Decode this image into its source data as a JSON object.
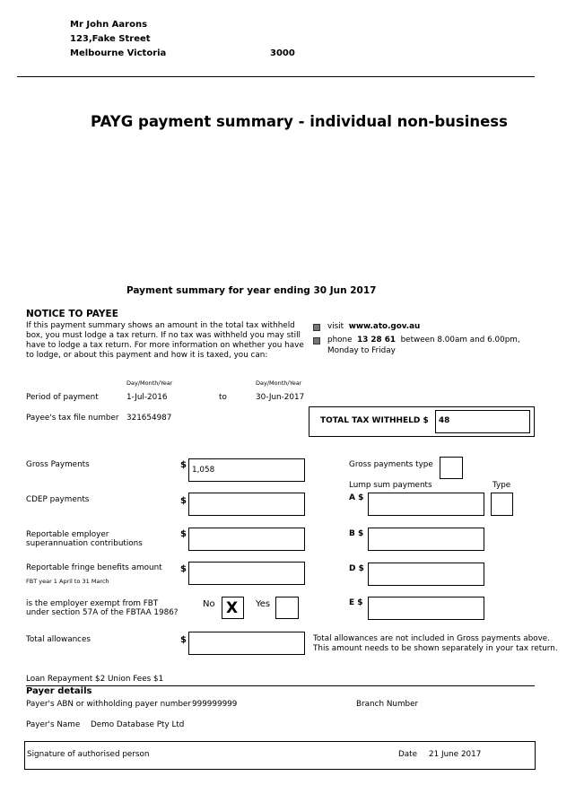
{
  "payee_address": {
    "name": "Mr John  Aarons",
    "street": "123,Fake Street",
    "city": "Melbourne Victoria",
    "postcode": "3000"
  },
  "document_title": "PAYG payment summary - individual non-business",
  "year_ending": {
    "label": "Payment summary for year ending",
    "value": "30 Jun 2017"
  },
  "notice": {
    "heading": "NOTICE TO PAYEE",
    "body_lines": [
      "If this payment summary shows an amount in the total tax withheld",
      "box, you must lodge a tax return. If no tax was withheld you may still",
      "have to lodge a tax return. For more information on whether you have",
      "to lodge, or about this payment and how it is taxed, you can:"
    ],
    "visit_label": "visit",
    "visit_url": "www.ato.gov.au",
    "phone_label": "phone",
    "phone_number": "13 28 61",
    "phone_hours": "between 8.00am and 6.00pm,",
    "phone_days": "Monday to Friday"
  },
  "period": {
    "date_format_label": "Day/Month/Year",
    "label": "Period of payment",
    "from": "1-Jul-2016",
    "to_label": "to",
    "to": "30-Jun-2017"
  },
  "tfn": {
    "label": "Payee's tax file number",
    "value": "321654987"
  },
  "total_tax": {
    "label": "TOTAL TAX WITHHELD $",
    "value": "48"
  },
  "fields": {
    "currency_symbol": "$",
    "gross_payments": {
      "label": "Gross Payments",
      "value": "1,058"
    },
    "cdep_payments": {
      "label": "CDEP  payments",
      "value": ""
    },
    "super_contributions": {
      "label_line1": "Reportable employer",
      "label_line2": "superannuation contributions",
      "value": ""
    },
    "fringe_benefits": {
      "label": "Reportable fringe benefits amount",
      "note": "FBT year 1 April to 31 March",
      "value": ""
    },
    "fbt_exempt": {
      "label_line1": "is the employer exempt from FBT",
      "label_line2": "under section 57A of the FBTAA 1986?",
      "no_label": "No",
      "no_mark": "X",
      "yes_label": "Yes",
      "yes_mark": ""
    },
    "total_allowances": {
      "label": "Total allowances",
      "value": "",
      "note_line1": "Total allowances are not included in Gross payments above.",
      "note_line2": "This amount needs to be shown separately in your tax return."
    }
  },
  "right_column": {
    "gross_payments_type_label": "Gross payments type",
    "gross_payments_type_value": "",
    "lump_sum_label": "Lump sum payments",
    "type_label": "Type",
    "a_label": "A  $",
    "a_value": "",
    "a_type": "",
    "b_label": "B  $",
    "b_value": "",
    "d_label": "D  $",
    "d_value": "",
    "e_label": "E  $",
    "e_value": ""
  },
  "deductions_note": "Loan Repayment $2  Union Fees $1",
  "payer": {
    "heading": "Payer details",
    "abn_label": "Payer's ABN or withholding payer number",
    "abn_value": "999999999",
    "branch_label": "Branch Number",
    "branch_value": "",
    "name_label": "Payer's Name",
    "name_value": "Demo Database Pty Ltd"
  },
  "signature": {
    "label": "Signature of authorised person",
    "date_label": "Date",
    "date_value": "21 June 2017"
  }
}
